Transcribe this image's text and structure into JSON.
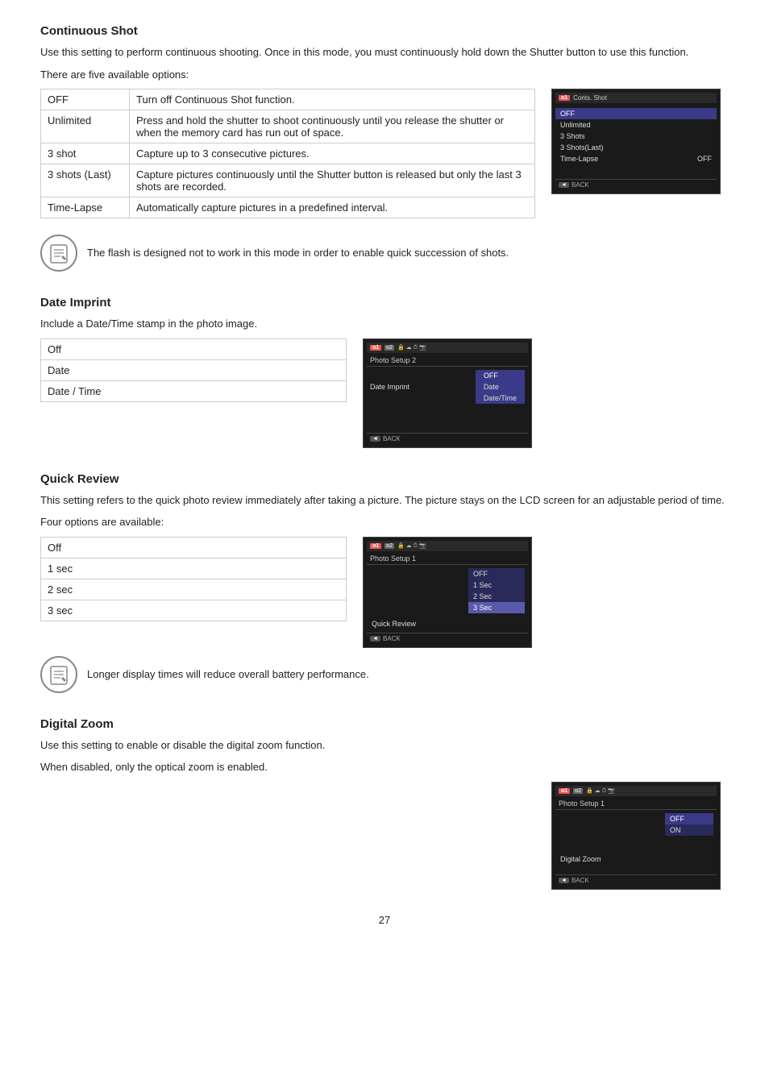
{
  "continuous_shot": {
    "title": "Continuous Shot",
    "description": "Use this setting to perform continuous shooting. Once in this mode, you must continuously hold down the Shutter button to use this function.",
    "options_intro": "There are five available options:",
    "options": [
      {
        "label": "OFF",
        "description": "Turn off Continuous Shot function."
      },
      {
        "label": "Unlimited",
        "description": "Press and hold the shutter to shoot continuously until you release the shutter or when the memory card has run out of space."
      },
      {
        "label": "3 shot",
        "description": "Capture up to 3 consecutive pictures."
      },
      {
        "label": "3 shots (Last)",
        "description": "Capture pictures continuously until the Shutter button is released but only the last 3 shots are recorded."
      },
      {
        "label": "Time-Lapse",
        "description": "Automatically capture pictures in a predefined interval."
      }
    ],
    "note": "The flash is designed not to work in this mode in order to enable quick succession of shots.",
    "lcd": {
      "header_icon": "o1",
      "menu_title": "Conts. Shot",
      "items": [
        "OFF",
        "Unlimited",
        "3 Shots",
        "3 Shots(Last)"
      ],
      "item_with_value": {
        "label": "Time-Lapse",
        "value": "OFF"
      },
      "back_label": "BACK"
    }
  },
  "date_imprint": {
    "title": "Date Imprint",
    "description": "Include a Date/Time stamp in the photo image.",
    "options": [
      {
        "label": "Off"
      },
      {
        "label": "Date"
      },
      {
        "label": "Date / Time"
      }
    ],
    "lcd": {
      "header_icon": "o1",
      "header_icon2": "o2",
      "menu_title": "Photo Setup 2",
      "menu_item": "Date Imprint",
      "sub_items": [
        "OFF",
        "Date",
        "Date/Time"
      ],
      "back_label": "BACK"
    }
  },
  "quick_review": {
    "title": "Quick Review",
    "description": "This setting refers to the quick photo review immediately after taking a picture. The picture stays on the LCD screen for an adjustable period of time.",
    "options_intro": "Four options are available:",
    "options": [
      {
        "label": "Off"
      },
      {
        "label": "1 sec"
      },
      {
        "label": "2 sec"
      },
      {
        "label": "3 sec"
      }
    ],
    "note": "Longer display times will reduce overall battery performance.",
    "lcd": {
      "header_icon": "o1",
      "header_icon2": "o2",
      "menu_title": "Photo Setup 1",
      "menu_item": "Quick Review",
      "sub_items": [
        "OFF",
        "1 Sec",
        "2 Sec",
        "3 Sec"
      ],
      "highlighted": "3 Sec",
      "back_label": "BACK"
    }
  },
  "digital_zoom": {
    "title": "Digital Zoom",
    "description1": "Use this setting to enable or disable the digital zoom function.",
    "description2": "When disabled, only the optical zoom is enabled.",
    "lcd": {
      "header_icon": "o1",
      "header_icon2": "o2",
      "menu_title": "Photo Setup 1",
      "sub_items": [
        "OFF",
        "ON"
      ],
      "menu_item": "Digital Zoom",
      "back_label": "BACK"
    }
  },
  "page_number": "27"
}
